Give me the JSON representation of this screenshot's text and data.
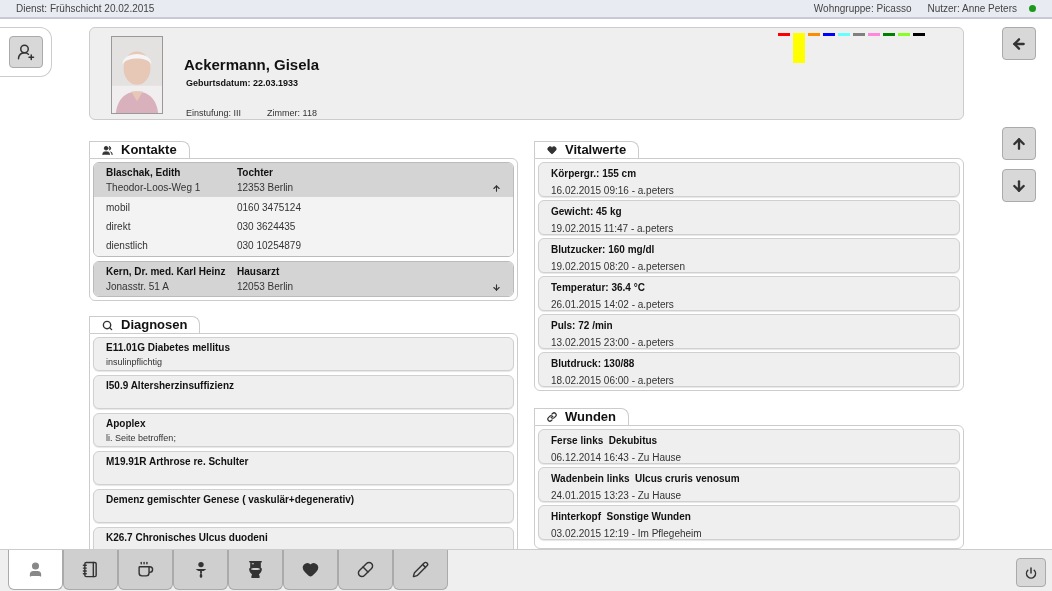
{
  "top_bar": {
    "shift": "Dienst: Frühschicht 20.02.2015",
    "group": "Wohngruppe: Picasso",
    "user": "Nutzer: Anne Peters",
    "online": true
  },
  "resident": {
    "name": "Ackermann, Gisela",
    "birth_label": "Geburtsdatum:",
    "birth_date": "22.03.1933",
    "rating": "Einstufung: III",
    "room": "Zimmer: 118",
    "markers": [
      {
        "color": "#ff0000",
        "selected": false
      },
      {
        "color": "#ffff00",
        "selected": true
      },
      {
        "color": "#ff8c00",
        "selected": false
      },
      {
        "color": "#0000ff",
        "selected": false
      },
      {
        "color": "#66ffff",
        "selected": false
      },
      {
        "color": "#808080",
        "selected": false
      },
      {
        "color": "#ff88dd",
        "selected": false
      },
      {
        "color": "#008000",
        "selected": false
      },
      {
        "color": "#88ff22",
        "selected": false
      },
      {
        "color": "#000000",
        "selected": false
      }
    ]
  },
  "contacts": {
    "title": "Kontakte",
    "items": [
      {
        "name": "Blaschak, Edith",
        "relation": "Tochter",
        "street": "Theodor-Loos-Weg 1",
        "city": "12353 Berlin",
        "expanded": true,
        "phones": [
          {
            "label": "mobil",
            "number": "0160 3475124"
          },
          {
            "label": "direkt",
            "number": "030 3624435"
          },
          {
            "label": "dienstlich",
            "number": "030 10254879"
          }
        ]
      },
      {
        "name": "Kern, Dr. med. Karl Heinz",
        "relation": "Hausarzt",
        "street": "Jonasstr. 51 A",
        "city": "12053 Berlin",
        "expanded": false
      }
    ]
  },
  "diagnoses": {
    "title": "Diagnosen",
    "items": [
      {
        "title": "E11.01G Diabetes mellitus",
        "note": "insulinpflichtig"
      },
      {
        "title": "I50.9 Altersherzinsuffizienz"
      },
      {
        "title": "Apoplex",
        "note": "li. Seite betroffen;"
      },
      {
        "title": "M19.91R Arthrose re. Schulter"
      },
      {
        "title": "Demenz gemischter Genese ( vaskulär+degenerativ)"
      },
      {
        "title": "K26.7 Chronisches Ulcus duodeni"
      }
    ]
  },
  "vitals": {
    "title": "Vitalwerte",
    "items": [
      {
        "label": "Körpergr.:",
        "value": "155 cm",
        "meta": "16.02.2015 09:16 - a.peters"
      },
      {
        "label": "Gewicht:",
        "value": "45 kg",
        "meta": "19.02.2015 11:47 - a.peters"
      },
      {
        "label": "Blutzucker:",
        "value": "160 mg/dl",
        "meta": "19.02.2015 08:20 - a.petersen"
      },
      {
        "label": "Temperatur:",
        "value": "36.4 °C",
        "meta": "26.01.2015 14:02 - a.peters"
      },
      {
        "label": "Puls:",
        "value": "72 /min",
        "meta": "13.02.2015 23:00 - a.peters"
      },
      {
        "label": "Blutdruck:",
        "value": "130/88",
        "meta": "18.02.2015 06:00 - a.peters"
      }
    ]
  },
  "wounds": {
    "title": "Wunden",
    "items": [
      {
        "location": "Ferse links",
        "type": "Dekubitus",
        "meta": "06.12.2014 16:43 - Zu Hause"
      },
      {
        "location": "Wadenbein links",
        "type": "Ulcus cruris venosum",
        "meta": "24.01.2015 13:23 - Zu Hause"
      },
      {
        "location": "Hinterkopf",
        "type": "Sonstige Wunden",
        "meta": "03.02.2015 12:19 - Im Pflegeheim"
      }
    ]
  },
  "bottom_tabs": [
    {
      "selected": true
    },
    {
      "selected": false
    },
    {
      "selected": false
    },
    {
      "selected": false
    },
    {
      "selected": false
    },
    {
      "selected": false
    },
    {
      "selected": false
    },
    {
      "selected": false
    }
  ]
}
